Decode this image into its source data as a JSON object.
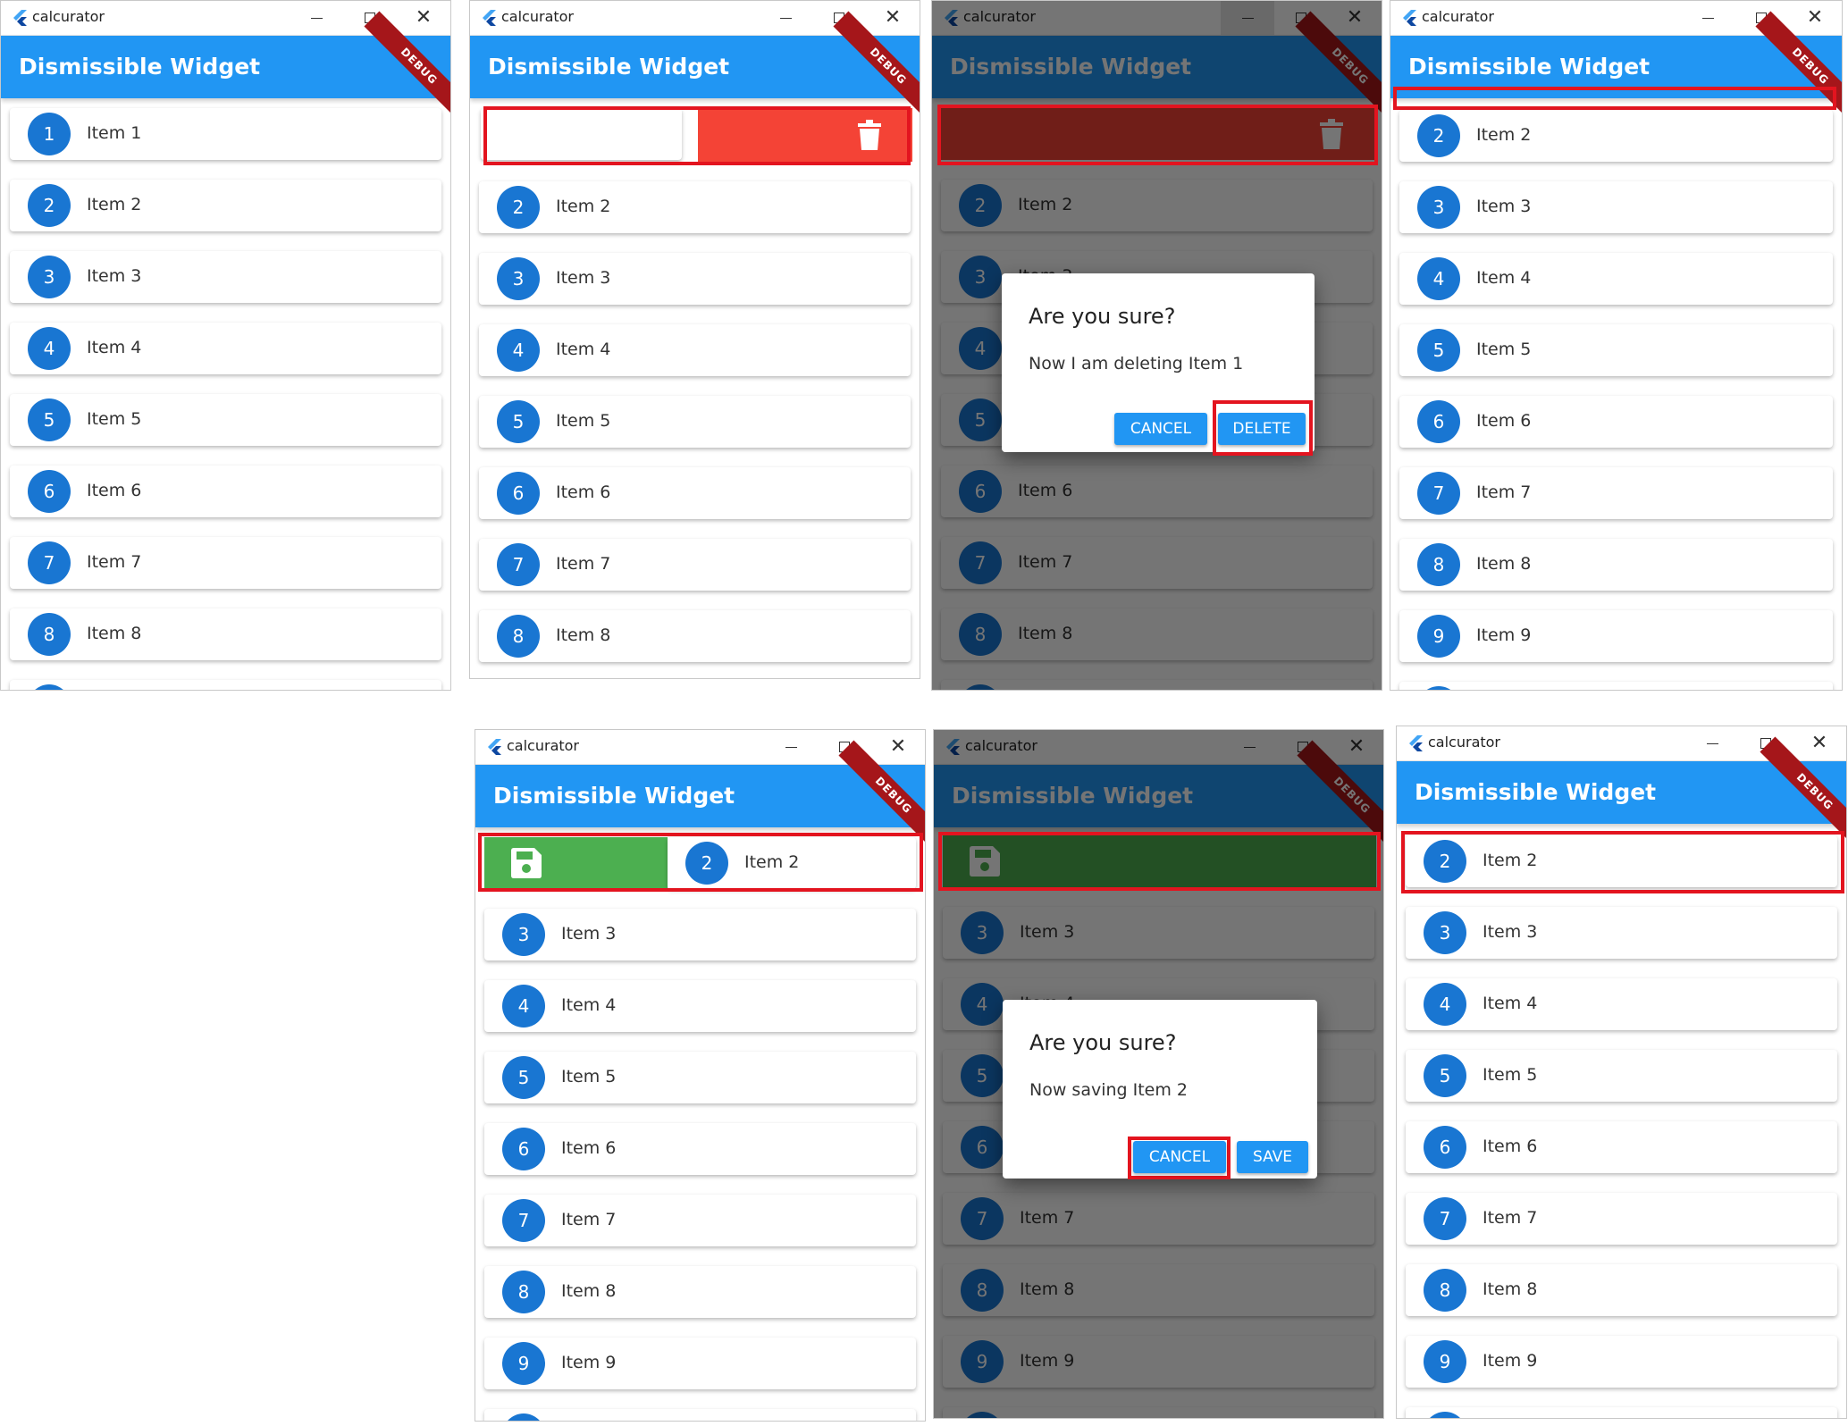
{
  "window_title": "calcurator",
  "app_title": "Dismissible Widget",
  "debug_banner": "DEBUG",
  "items": {
    "i1": {
      "num": "1",
      "label": "Item 1"
    },
    "i2": {
      "num": "2",
      "label": "Item 2"
    },
    "i3": {
      "num": "3",
      "label": "Item 3"
    },
    "i4": {
      "num": "4",
      "label": "Item 4"
    },
    "i5": {
      "num": "5",
      "label": "Item 5"
    },
    "i6": {
      "num": "6",
      "label": "Item 6"
    },
    "i7": {
      "num": "7",
      "label": "Item 7"
    },
    "i8": {
      "num": "8",
      "label": "Item 8"
    },
    "i9": {
      "num": "9",
      "label": "Item 9"
    }
  },
  "delete_dialog": {
    "title": "Are you sure?",
    "message": "Now I am deleting Item 1",
    "cancel_label": "CANCEL",
    "confirm_label": "DELETE"
  },
  "save_dialog": {
    "title": "Are you sure?",
    "message": "Now saving Item 2",
    "cancel_label": "CANCEL",
    "confirm_label": "SAVE"
  },
  "icons": {
    "delete": "trash-icon",
    "save": "floppy-disk-icon",
    "logo": "flutter-logo-icon"
  },
  "colors": {
    "app_bar": "#2196f3",
    "avatar": "#1976d2",
    "delete_background": "#f44336",
    "save_background": "#4caf50",
    "highlight": "#e3141f",
    "debug_ribbon": "#a5161a"
  }
}
